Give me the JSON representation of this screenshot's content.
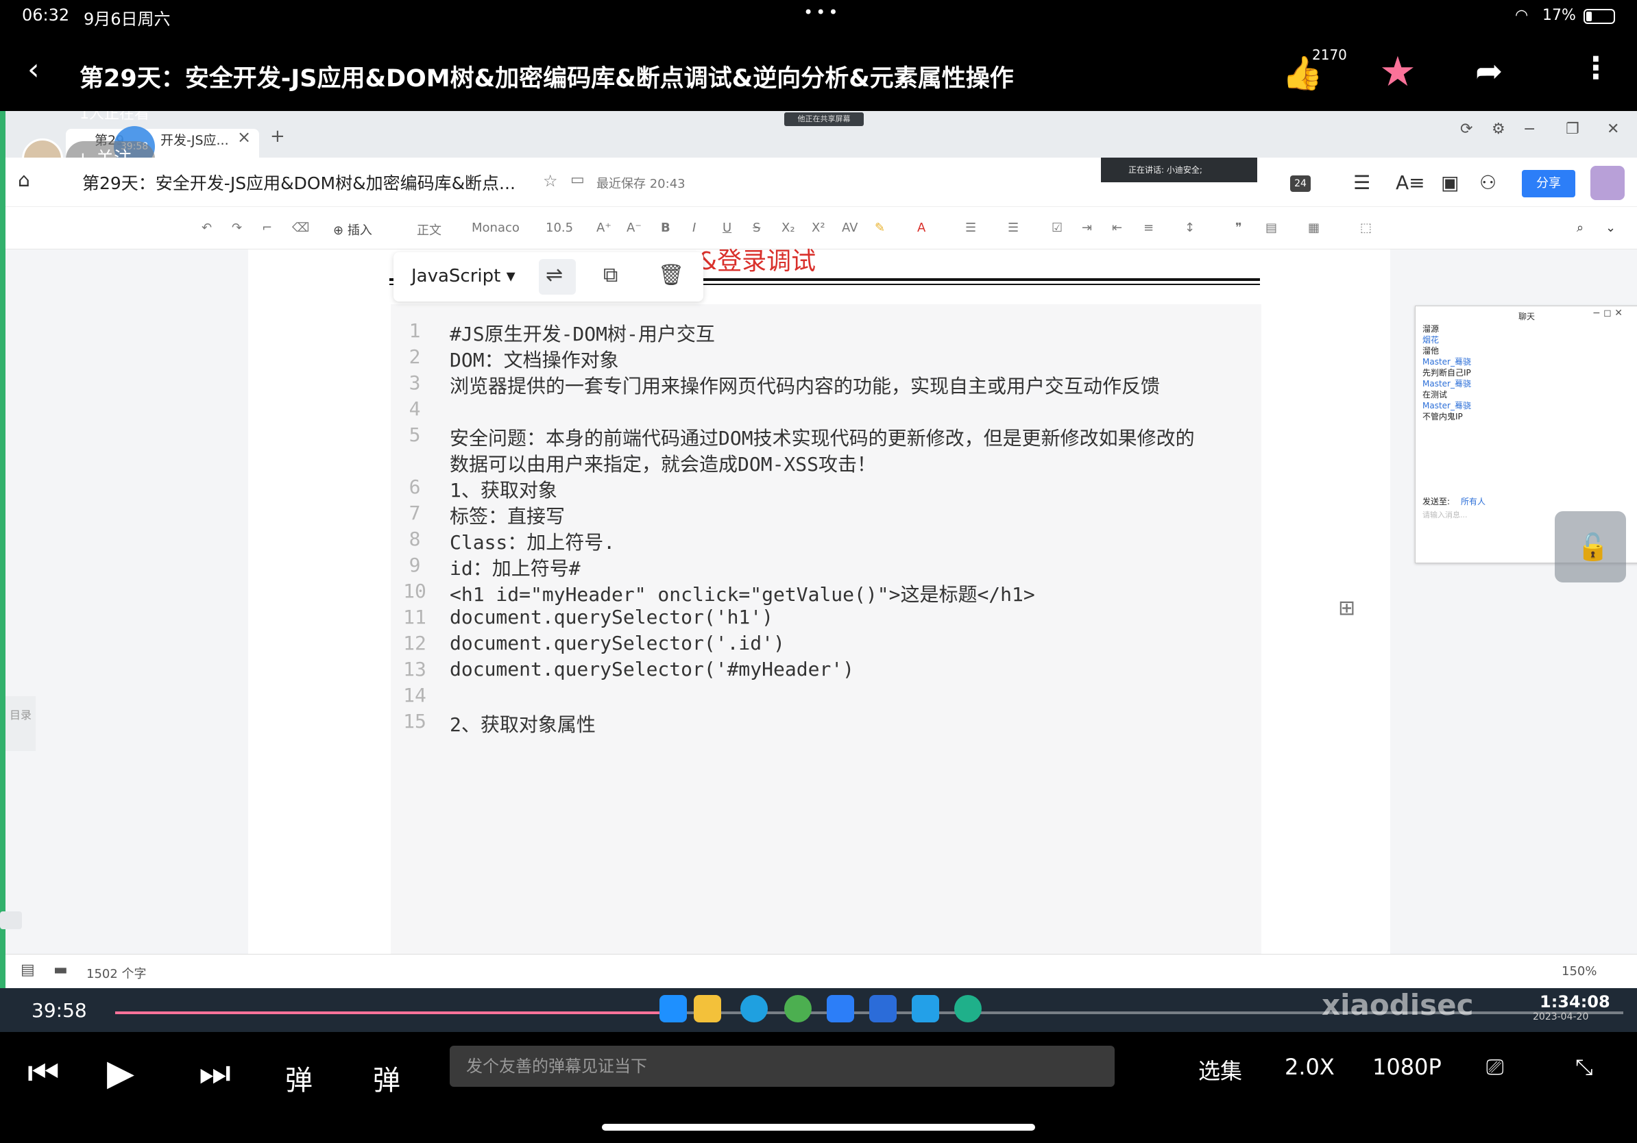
{
  "status": {
    "time": "06:32",
    "date": "9月6日周六",
    "battery": "17%"
  },
  "header": {
    "title": "第29天：安全开发-JS应用&DOM树&加密编码库&断点调试&逆向分析&元素属性操作",
    "likes": "2170",
    "watching": "1人正在看",
    "follow_label": "+ 关注"
  },
  "browser": {
    "tab_label": "第29",
    "tab_label2": "开发-JS应...",
    "timer": "39:58",
    "sharing_label": "他正在共享屏幕"
  },
  "doc": {
    "name": "第29天：安全开发-JS应用&DOM树&加密编码库&断点...",
    "saved": "最近保存 20:43",
    "speaking": "正在讲话: 小迪安全;",
    "members": "24",
    "share_btn": "分享",
    "word_count": "1502 个字",
    "zoom": "150%",
    "toc": "目录"
  },
  "toolbar": {
    "insert": "插入",
    "style": "正文",
    "font": "Monaco",
    "size": "10.5"
  },
  "code": {
    "language": "JavaScript",
    "heading_fragment": "&登录调试",
    "lines": [
      {
        "n": "1",
        "t": "#JS原生开发-DOM树-用户交互"
      },
      {
        "n": "2",
        "t": "DOM：文档操作对象"
      },
      {
        "n": "3",
        "t": "浏览器提供的一套专门用来操作网页代码内容的功能，实现自主或用户交互动作反馈"
      },
      {
        "n": "4",
        "t": ""
      },
      {
        "n": "5",
        "t": "安全问题：本身的前端代码通过DOM技术实现代码的更新修改，但是更新修改如果修改的"
      },
      {
        "n": "",
        "t": "数据可以由用户来指定，就会造成DOM-XSS攻击！"
      },
      {
        "n": "6",
        "t": "1、获取对象"
      },
      {
        "n": "7",
        "t": "标签：直接写"
      },
      {
        "n": "8",
        "t": "Class：加上符号."
      },
      {
        "n": "9",
        "t": "id：加上符号#"
      },
      {
        "n": "10",
        "t": "<h1 id=\"myHeader\" onclick=\"getValue()\">这是标题</h1>"
      },
      {
        "n": "11",
        "t": "document.querySelector('h1')"
      },
      {
        "n": "12",
        "t": "document.querySelector('.id')"
      },
      {
        "n": "13",
        "t": "document.querySelector('#myHeader')"
      },
      {
        "n": "14",
        "t": ""
      },
      {
        "n": "15",
        "t": "2、获取对象属性"
      }
    ]
  },
  "chat": {
    "title": "聊天",
    "lines": [
      "溜源",
      "烟花",
      "溜他",
      "Master_蓦骁",
      "先判断自己IP",
      "Master_蓦骁",
      "在测试",
      "Master_蓦骁",
      "不管内鬼IP"
    ],
    "send_to_label": "发送至:",
    "send_to_value": "所有人",
    "placeholder": "请输入消息..."
  },
  "windows": {
    "clock": "1:34:08",
    "date": "2023-04-20",
    "watermark": "xiaodisec"
  },
  "player": {
    "current_time": "39:58",
    "danmu_placeholder": "发个友善的弹幕见证当下",
    "episodes": "选集",
    "speed": "2.0X",
    "quality": "1080P",
    "progress": 0.37
  }
}
